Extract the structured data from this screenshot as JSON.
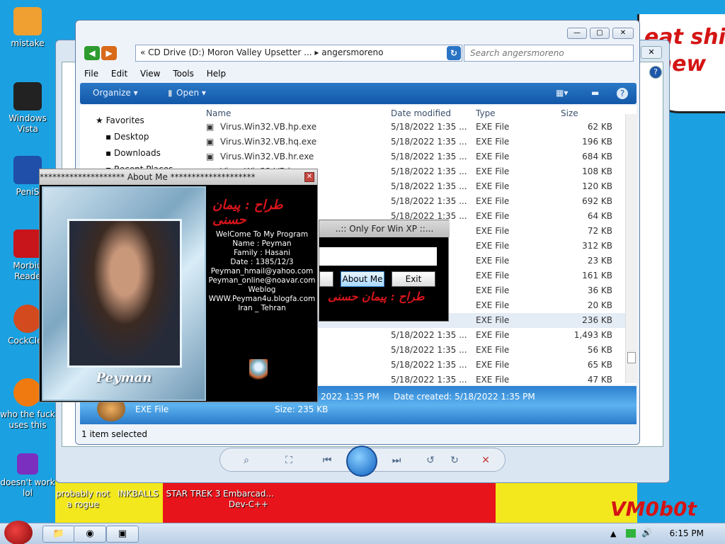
{
  "desktop": {
    "wallpaper_text": "eat shi\nchew",
    "watermark": "VM0b0t",
    "icons": [
      {
        "label": "mistake",
        "color": "#f0a030"
      },
      {
        "label": "Windows Vista",
        "color": "#222222"
      },
      {
        "label": "PeniS",
        "color": "#1f4fa8"
      },
      {
        "label": "Morbiu Reade",
        "color": "#c8141b"
      },
      {
        "label": "CockClea",
        "color": "#d24a1e"
      },
      {
        "label": "who the fuck uses this",
        "color": "#f07a10"
      },
      {
        "label": "doesn't work lol",
        "color": "#7a2fbf"
      },
      {
        "label": "probably not a rogue",
        "color": "#6a8ab0"
      },
      {
        "label": "INKBALLS",
        "color": "#6a8ab0"
      },
      {
        "label": "STAR TREK 3",
        "color": "#6a8ab0"
      },
      {
        "label": "Embarcad... Dev-C++",
        "color": "#6a8ab0"
      }
    ]
  },
  "explorer": {
    "address": "«  CD Drive (D:) Moron Valley Upsetter ...  ▸  angersmoreno",
    "search_placeholder": "Search angersmoreno",
    "menu": [
      "File",
      "Edit",
      "View",
      "Tools",
      "Help"
    ],
    "toolbar": {
      "organize": "Organize ▾",
      "open": "Open ▾"
    },
    "nav": {
      "favorites": "Favorites",
      "desktop": "Desktop",
      "downloads": "Downloads",
      "recent": "Recent Places"
    },
    "columns": [
      "Name",
      "Date modified",
      "Type",
      "Size"
    ],
    "rows": [
      {
        "name": "Virus.Win32.VB.hp.exe",
        "date": "5/18/2022 1:35 ...",
        "type": "EXE File",
        "size": "62 KB"
      },
      {
        "name": "Virus.Win32.VB.hq.exe",
        "date": "5/18/2022 1:35 ...",
        "type": "EXE File",
        "size": "196 KB"
      },
      {
        "name": "Virus.Win32.VB.hr.exe",
        "date": "5/18/2022 1:35 ...",
        "type": "EXE File",
        "size": "684 KB"
      },
      {
        "name": "Virus.Win32.VB.hs.exe",
        "date": "5/18/2022 1:35 ...",
        "type": "EXE File",
        "size": "108 KB"
      },
      {
        "name": "",
        "date": "5/18/2022 1:35 ...",
        "type": "EXE File",
        "size": "120 KB"
      },
      {
        "name": "",
        "date": "5/18/2022 1:35 ...",
        "type": "EXE File",
        "size": "692 KB"
      },
      {
        "name": "",
        "date": "5/18/2022 1:35 ...",
        "type": "EXE File",
        "size": "64 KB"
      },
      {
        "name": "",
        "date": "",
        "type": "EXE File",
        "size": "72 KB"
      },
      {
        "name": "",
        "date": "",
        "type": "EXE File",
        "size": "312 KB"
      },
      {
        "name": "",
        "date": "",
        "type": "EXE File",
        "size": "23 KB"
      },
      {
        "name": "",
        "date": "",
        "type": "EXE File",
        "size": "161 KB"
      },
      {
        "name": "",
        "date": "",
        "type": "EXE File",
        "size": "36 KB"
      },
      {
        "name": "",
        "date": "",
        "type": "EXE File",
        "size": "20 KB"
      },
      {
        "name": "",
        "date": "",
        "type": "EXE File",
        "size": "236 KB"
      },
      {
        "name": "",
        "date": "5/18/2022 1:35 ...",
        "type": "EXE File",
        "size": "1,493 KB"
      },
      {
        "name": "",
        "date": "5/18/2022 1:35 ...",
        "type": "EXE File",
        "size": "56 KB"
      },
      {
        "name": "",
        "date": "5/18/2022 1:35 ...",
        "type": "EXE File",
        "size": "65 KB"
      },
      {
        "name": "",
        "date": "5/18/2022 1:35 ...",
        "type": "EXE File",
        "size": "47 KB"
      }
    ],
    "details": {
      "modified": "2022 1:35 PM",
      "created": "Date created: 5/18/2022 1:35 PM",
      "type": "EXE File",
      "size": "Size: 235 KB"
    },
    "status": "1 item selected"
  },
  "xp_window": {
    "title": "..:: Only For Win XP ::...",
    "about_btn": "About Me",
    "exit_btn": "Exit",
    "signature": "طراح : پیمان حسنی"
  },
  "about": {
    "title": "********************        About Me        ********************",
    "photo_name": "Peyman",
    "signature": "طراح : پیمان حسنی",
    "lines": [
      "WelCome To My Program",
      "Name : Peyman",
      "Family : Hasani",
      "Date : 1385/12/3",
      "Peyman_hmail@yahoo.com",
      "Peyman_online@noavar.com",
      "Weblog",
      "WWW.Peyman4u.blogfa.com",
      "Iran _ Tehran"
    ]
  },
  "taskbar": {
    "clock": "6:15 PM"
  }
}
